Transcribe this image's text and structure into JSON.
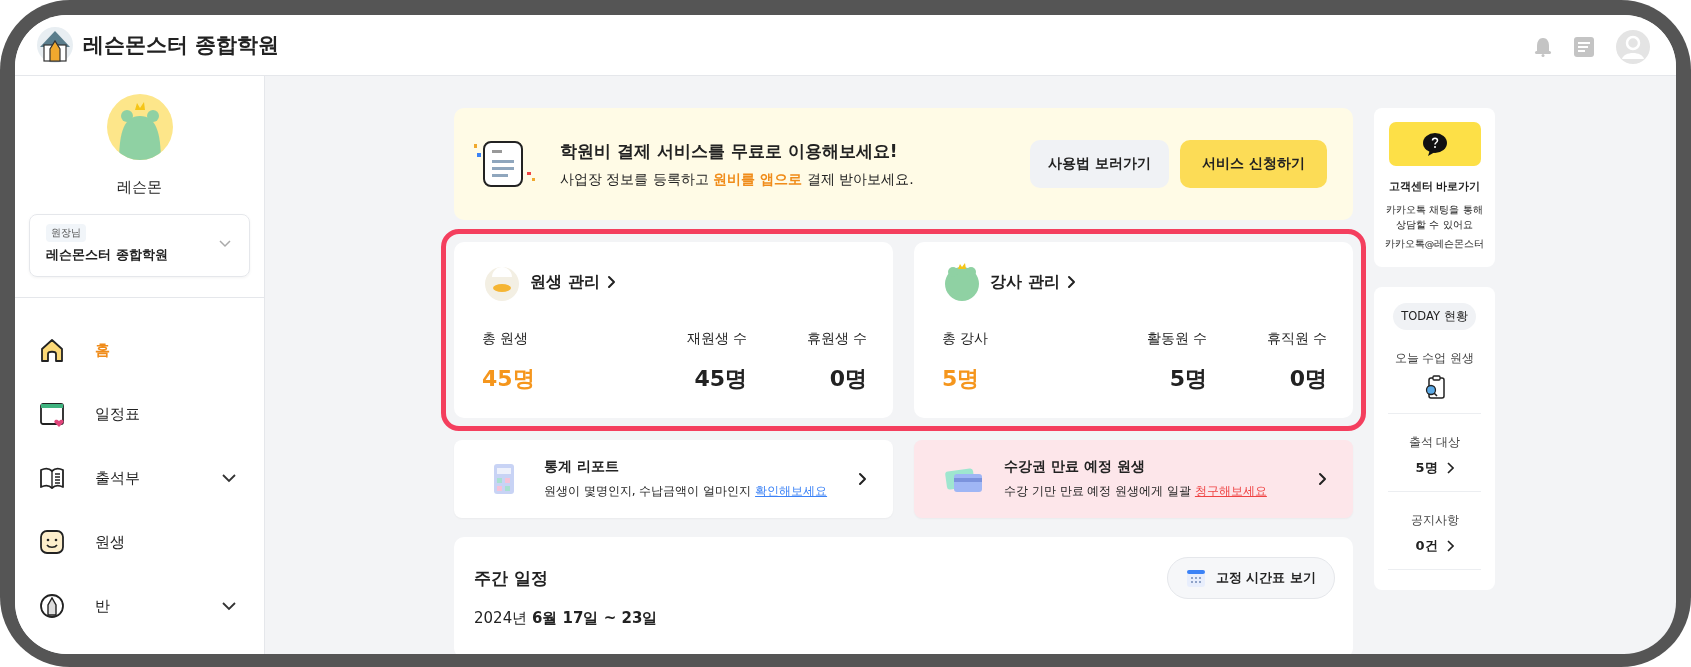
{
  "header": {
    "title": "레슨몬스터 종합학원"
  },
  "sidebar": {
    "profile_name": "레슨몬",
    "academy": {
      "role": "원장님",
      "name": "레슨몬스터 종합학원"
    },
    "nav": [
      {
        "label": "홈",
        "selected": true,
        "expandable": false
      },
      {
        "label": "일정표",
        "selected": false,
        "expandable": false
      },
      {
        "label": "출석부",
        "selected": false,
        "expandable": true
      },
      {
        "label": "원생",
        "selected": false,
        "expandable": false
      },
      {
        "label": "반",
        "selected": false,
        "expandable": true
      }
    ]
  },
  "banner": {
    "title": "학원비 결제 서비스를 무료로 이용해보세요!",
    "text": "사업장 정보를 등록하고 **원비를 앱으로** 결제 받아보세요.",
    "buttons": [
      {
        "label": "사용법 보러가기",
        "kind": "secondary"
      },
      {
        "label": "서비스 신청하기",
        "kind": "primary"
      }
    ]
  },
  "management": {
    "highlighted": true,
    "cards": [
      {
        "title": "원생 관리",
        "stats": [
          {
            "label": "총 원생",
            "value": "45명",
            "accent": true
          },
          {
            "label": "재원생 수",
            "value": "45명",
            "accent": false
          },
          {
            "label": "휴원생 수",
            "value": "0명",
            "accent": false
          }
        ]
      },
      {
        "title": "강사 관리",
        "stats": [
          {
            "label": "총 강사",
            "value": "5명",
            "accent": true
          },
          {
            "label": "활동원 수",
            "value": "5명",
            "accent": false
          },
          {
            "label": "휴직원 수",
            "value": "0명",
            "accent": false
          }
        ]
      }
    ]
  },
  "promos": [
    {
      "kind": "plain",
      "title": "통계 리포트",
      "text": "원생이 몇명인지, 수납금액이 얼마인지 ",
      "link": "확인해보세요"
    },
    {
      "kind": "alert",
      "title": "수강권 만료 예정 원생",
      "text": "수강 기만 만료 예정 원생에게 일괄 ",
      "link": "청구해보세요"
    }
  ],
  "weekly": {
    "title": "주간 일정",
    "button": "고정 시간표 보기",
    "date": "2024년 **6월 17일 ~ 23일**"
  },
  "support": {
    "title": "고객센터 바로가기",
    "text": "카카오톡 채팅을 통해 상담할 수 있어요",
    "contact": "카카오톡@레슨몬스터"
  },
  "today": {
    "badge": "TODAY 현황",
    "items": [
      {
        "kind": "icon",
        "label": "오늘 수업 원생"
      },
      {
        "kind": "value",
        "label": "출석 대상",
        "value": "5명"
      },
      {
        "kind": "value",
        "label": "공지사항",
        "value": "0건"
      }
    ]
  }
}
